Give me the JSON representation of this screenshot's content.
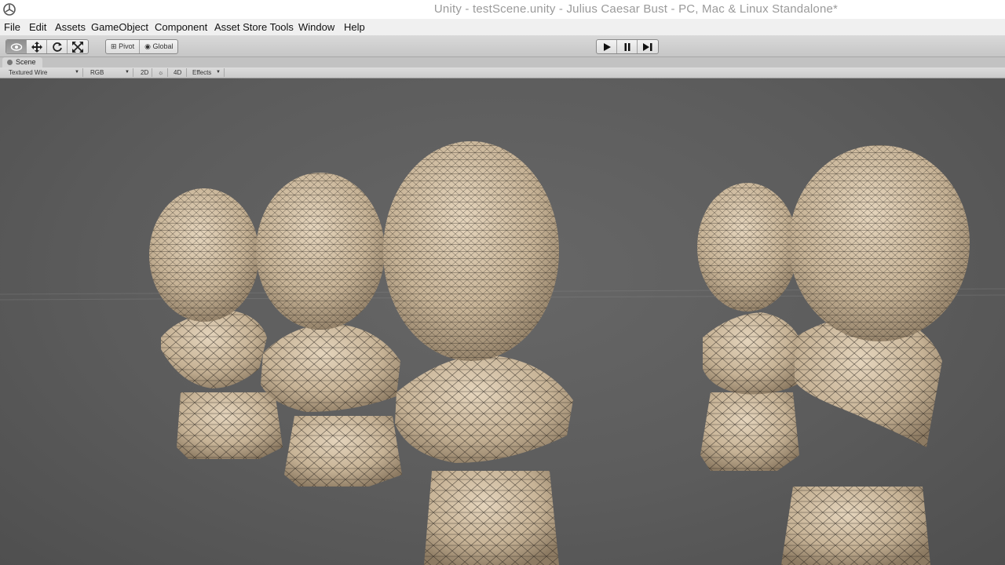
{
  "window": {
    "title": "Unity - testScene.unity - Julius Caesar Bust - PC, Mac & Linux Standalone*"
  },
  "menu": [
    {
      "label": "File"
    },
    {
      "label": "Edit"
    },
    {
      "label": "Assets"
    },
    {
      "label": "GameObject"
    },
    {
      "label": "Component"
    },
    {
      "label": "Asset Store Tools"
    },
    {
      "label": "Window"
    },
    {
      "label": "Help"
    }
  ],
  "toolbar": {
    "tools": [
      "hand-icon",
      "move-icon",
      "rotate-icon",
      "scale-icon"
    ],
    "pivot_label": "Pivot",
    "global_label": "Global",
    "playback": [
      "play-icon",
      "pause-icon",
      "step-icon"
    ]
  },
  "scene": {
    "tab_label": "Scene",
    "render_mode": "Textured Wire",
    "color_mode": "RGB",
    "mode_2d": "2D",
    "mode_3d": "4D",
    "effects_label": "Effects"
  },
  "viewport": {
    "objects": [
      {
        "name": "Julius Caesar bust (left profile)"
      },
      {
        "name": "Julius Caesar bust (left front)"
      },
      {
        "name": "Julius Caesar bust (center)"
      },
      {
        "name": "Julius Caesar bust (right profile)"
      },
      {
        "name": "Julius Caesar bust (right back)"
      }
    ]
  },
  "colors": {
    "viewport_bg": "#5a5a5a",
    "bust_fill": "#c9b59a",
    "wire": "#2a2520"
  }
}
